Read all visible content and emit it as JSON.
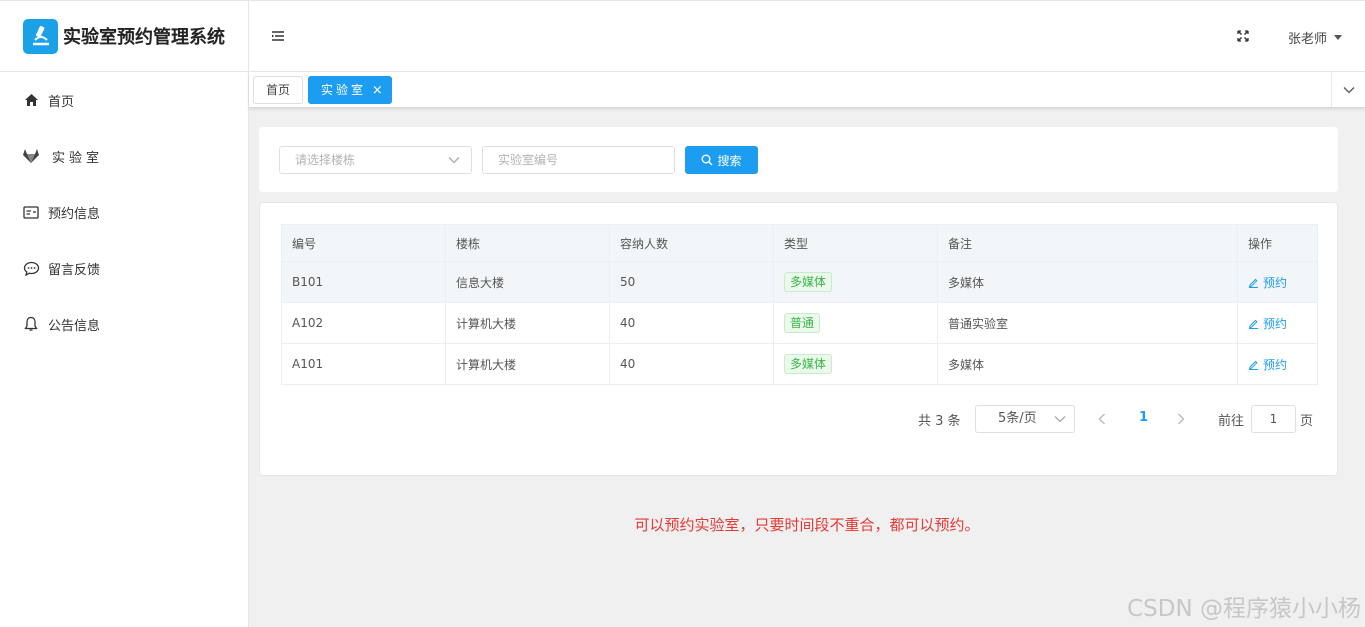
{
  "app": {
    "title": "实验室预约管理系统",
    "brand_color": "#1aa1e8"
  },
  "sidebar": {
    "items": [
      {
        "label": "首页",
        "icon": "home-icon"
      },
      {
        "label": "实验室",
        "icon": "gitlab-fox-icon"
      },
      {
        "label": "预约信息",
        "icon": "id-card-icon"
      },
      {
        "label": "留言反馈",
        "icon": "chat-bubble-icon"
      },
      {
        "label": "公告信息",
        "icon": "bell-icon"
      }
    ]
  },
  "header": {
    "user_name": "张老师"
  },
  "tags": {
    "home": "首页",
    "active": "实验室"
  },
  "search": {
    "building_placeholder": "请选择楼栋",
    "room_placeholder": "实验室编号",
    "button_label": "搜索"
  },
  "table": {
    "columns": [
      "编号",
      "楼栋",
      "容纳人数",
      "类型",
      "备注",
      "操作"
    ],
    "rows": [
      {
        "code": "B101",
        "building": "信息大楼",
        "capacity": "50",
        "type": "多媒体",
        "remark": "多媒体",
        "action": "预约"
      },
      {
        "code": "A102",
        "building": "计算机大楼",
        "capacity": "40",
        "type": "普通",
        "remark": "普通实验室",
        "action": "预约"
      },
      {
        "code": "A101",
        "building": "计算机大楼",
        "capacity": "40",
        "type": "多媒体",
        "remark": "多媒体",
        "action": "预约"
      }
    ]
  },
  "pagination": {
    "total_text": "共 3 条",
    "page_size": "5条/页",
    "current_page": "1",
    "goto_prefix": "前往",
    "goto_value": "1",
    "goto_suffix": "页"
  },
  "note": "可以预约实验室，只要时间段不重合，都可以预约。",
  "watermark": "CSDN @程序猿小小杨"
}
